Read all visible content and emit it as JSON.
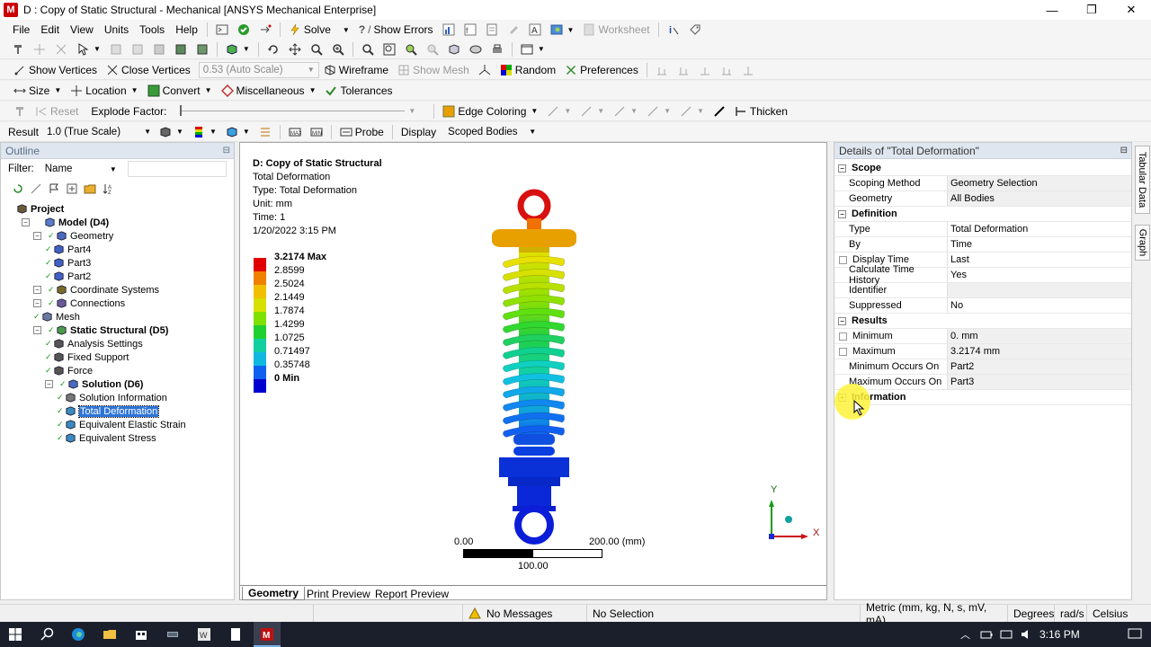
{
  "window": {
    "title": "D : Copy of Static Structural - Mechanical [ANSYS Mechanical Enterprise]",
    "app_badge": "M",
    "controls": [
      "—",
      "❐",
      "✕"
    ]
  },
  "menu": [
    "File",
    "Edit",
    "View",
    "Units",
    "Tools",
    "Help"
  ],
  "toolbar1": {
    "solve": "Solve",
    "show_errors": "Show Errors",
    "worksheet": "Worksheet"
  },
  "toolbar3": {
    "show_vertices": "Show Vertices",
    "close_vertices": "Close Vertices",
    "scale": "0.53 (Auto Scale)",
    "wireframe": "Wireframe",
    "show_mesh": "Show Mesh",
    "random": "Random",
    "preferences": "Preferences"
  },
  "toolbar4": {
    "size": "Size",
    "location": "Location",
    "convert": "Convert",
    "miscellaneous": "Miscellaneous",
    "tolerances": "Tolerances"
  },
  "toolbar5": {
    "reset": "Reset",
    "explode_factor": "Explode Factor:",
    "edge_coloring": "Edge Coloring",
    "thicken": "Thicken"
  },
  "toolbar6": {
    "result_label": "Result",
    "result_scale": "1.0 (True Scale)",
    "probe": "Probe",
    "display_label": "Display",
    "display_value": "Scoped Bodies"
  },
  "outline": {
    "title": "Outline",
    "pin": "⊟",
    "filter_label": "Filter:",
    "filter_value": "Name",
    "nodes": [
      {
        "label": "Project",
        "bold": true
      },
      {
        "label": "Model (D4)",
        "bold": true
      },
      {
        "label": "Geometry"
      },
      {
        "label": "Part4"
      },
      {
        "label": "Part3"
      },
      {
        "label": "Part2"
      },
      {
        "label": "Coordinate Systems"
      },
      {
        "label": "Connections"
      },
      {
        "label": "Mesh"
      },
      {
        "label": "Static Structural (D5)",
        "bold": true
      },
      {
        "label": "Analysis Settings"
      },
      {
        "label": "Fixed Support"
      },
      {
        "label": "Force"
      },
      {
        "label": "Solution (D6)",
        "bold": true
      },
      {
        "label": "Solution Information"
      },
      {
        "label": "Total Deformation",
        "selected": true
      },
      {
        "label": "Equivalent Elastic Strain"
      },
      {
        "label": "Equivalent Stress"
      }
    ]
  },
  "graphics": {
    "info": [
      "D: Copy of Static Structural",
      "Total Deformation",
      "Type: Total Deformation",
      "Unit: mm",
      "Time: 1",
      "1/20/2022 3:15 PM"
    ],
    "legend": {
      "labels": [
        "3.2174 Max",
        "2.8599",
        "2.5024",
        "2.1449",
        "1.7874",
        "1.4299",
        "1.0725",
        "0.71497",
        "0.35748",
        "0 Min"
      ],
      "colors": [
        "#e00000",
        "#f08000",
        "#f0c000",
        "#d8e000",
        "#80e000",
        "#20d030",
        "#10d0a0",
        "#10b8e0",
        "#1060f0",
        "#0000d0"
      ]
    },
    "scale": {
      "start": "0.00",
      "end": "200.00 (mm)",
      "mid": "100.00"
    },
    "triad": {
      "x": "X",
      "y": "Y"
    },
    "tabs": [
      "Geometry",
      "Print Preview",
      "Report Preview"
    ]
  },
  "details": {
    "title": "Details of \"Total Deformation\"",
    "pin": "⊟",
    "rows": [
      {
        "type": "section",
        "key": "Scope"
      },
      {
        "key": "Scoping Method",
        "value": "Geometry Selection",
        "gray": true
      },
      {
        "key": "Geometry",
        "value": "All Bodies",
        "gray": true
      },
      {
        "type": "section",
        "key": "Definition"
      },
      {
        "key": "Type",
        "value": "Total Deformation"
      },
      {
        "key": "By",
        "value": "Time"
      },
      {
        "key": "Display Time",
        "value": "Last",
        "checkbox": true
      },
      {
        "key": "Calculate Time History",
        "value": "Yes"
      },
      {
        "key": "Identifier",
        "value": "",
        "gray": true
      },
      {
        "key": "Suppressed",
        "value": "No"
      },
      {
        "type": "section",
        "key": "Results"
      },
      {
        "key": "Minimum",
        "value": "0. mm",
        "checkbox": true,
        "gray": true
      },
      {
        "key": "Maximum",
        "value": "3.2174 mm",
        "checkbox": true,
        "gray": true
      },
      {
        "key": "Minimum Occurs On",
        "value": "Part2",
        "gray": true
      },
      {
        "key": "Maximum Occurs On",
        "value": "Part3",
        "gray": true
      },
      {
        "type": "section",
        "key": "Information",
        "collapsed": true
      }
    ]
  },
  "side_tabs": [
    "Tabular Data",
    "Graph"
  ],
  "status": {
    "messages": "No Messages",
    "selection": "No Selection",
    "units": "Metric (mm, kg, N, s, mV, mA)",
    "angle": "Degrees",
    "rot": "rad/s",
    "temp": "Celsius"
  },
  "taskbar": {
    "time": "3:16 PM"
  }
}
